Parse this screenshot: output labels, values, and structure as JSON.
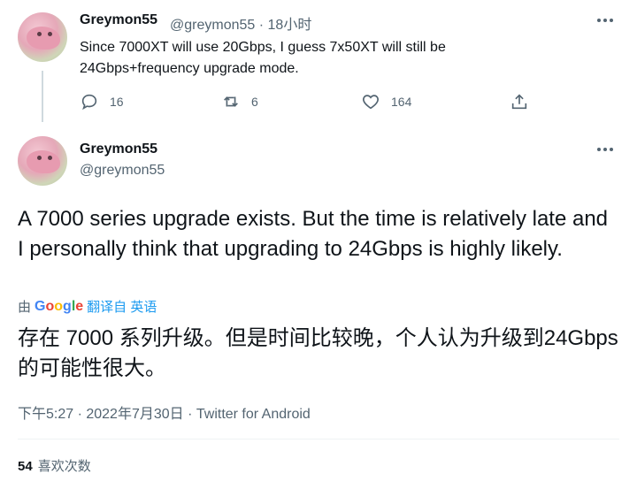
{
  "reply": {
    "display_name": "Greymon55",
    "handle": "@greymon55",
    "separator": "·",
    "time_ago": "18小时",
    "text": "Since 7000XT will use 20Gbps, I guess 7x50XT will still be 24Gbps+frequency upgrade mode.",
    "actions": {
      "reply_count": "16",
      "retweet_count": "6",
      "like_count": "164"
    }
  },
  "tweet": {
    "display_name": "Greymon55",
    "handle": "@greymon55",
    "text": "A 7000 series upgrade exists. But the time is relatively late and I personally think that upgrading to 24Gbps is highly likely.",
    "translate": {
      "prefix": "由",
      "provider": "Google",
      "link": "翻译自 英语"
    },
    "translation": "存在 7000 系列升级。但是时间比较晚，个人认为升级到24Gbps的可能性很大。",
    "meta": "下午5:27 · 2022年7月30日 · Twitter for Android",
    "likes_count": "54",
    "likes_label": "喜欢次数"
  },
  "colors": {
    "text": "#0f1419",
    "secondary": "#536471",
    "link": "#1d9bf0",
    "divider": "#eff3f4",
    "google_blue": "#4285f4",
    "google_red": "#ea4335",
    "google_yellow": "#fbbc05",
    "google_green": "#34a853"
  },
  "icons": {
    "reply": "comment-bubble-icon",
    "retweet": "retweet-icon",
    "like": "heart-icon",
    "share": "share-icon",
    "more": "more-dots-icon"
  }
}
